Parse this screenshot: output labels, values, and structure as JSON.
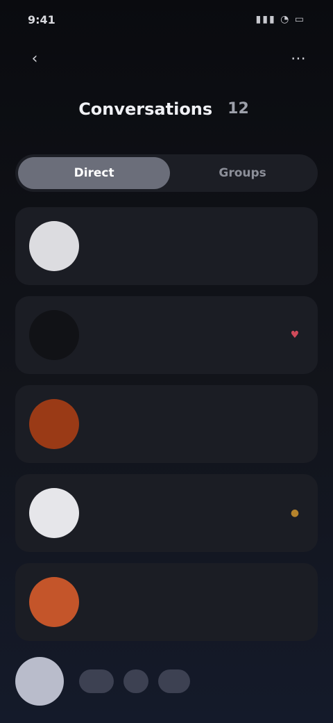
{
  "status_bar": {
    "time": "9:41",
    "icons": "▮▮▮ ◔ ▭"
  },
  "topbar": {
    "back_icon": "chevron-left-icon",
    "more_icon": "more-icon"
  },
  "header": {
    "title": "Conversations",
    "count": "12"
  },
  "tabs": [
    {
      "label": "Direct",
      "active": true
    },
    {
      "label": "Groups",
      "active": false
    }
  ],
  "cards": [
    {
      "label": "",
      "name": "",
      "avatar_color": "#dcdce0",
      "avatar_initial": "",
      "badge": "",
      "badge_color": ""
    },
    {
      "label": "",
      "name": "",
      "avatar_color": "#111216",
      "avatar_initial": "",
      "badge": "♥",
      "badge_color": "#d04a5a"
    },
    {
      "label": "",
      "name": "",
      "avatar_color": "#9a3a16",
      "avatar_initial": "",
      "badge": "",
      "badge_color": ""
    },
    {
      "label": "",
      "name": "",
      "avatar_color": "#e6e6ea",
      "avatar_initial": "",
      "badge": "●",
      "badge_color": "#b5832c"
    },
    {
      "label": "",
      "name": "",
      "avatar_color": "#c4552a",
      "avatar_initial": "",
      "badge": "",
      "badge_color": ""
    }
  ],
  "bottom": {
    "pills": [
      "",
      "",
      ""
    ]
  },
  "colors": {
    "accent": "#6b6e7a",
    "card_bg": "#1b1d24",
    "background": "#0d0f14"
  }
}
